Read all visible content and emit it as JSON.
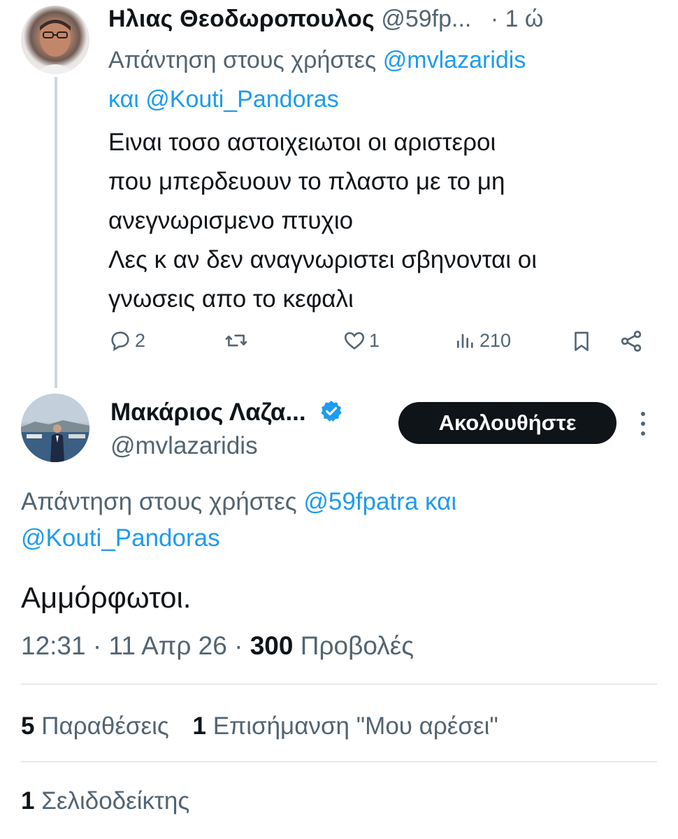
{
  "tweet1": {
    "author_name": "Ηλιας Θεοδωροπουλος",
    "author_handle": "@59fp...",
    "time": "· 1 ώ",
    "reply_prefix": "Απάντηση στους χρήστες",
    "mention_1": "@mvlazaridis",
    "connector": "και",
    "mention_2": "@Kouti_Pandoras",
    "text_lines": [
      "Ειναι τοσο αστοιχειωτοι οι αριστεροι",
      "που μπερδευουν το πλαστο με το μη",
      "ανεγνωρισμενο πτυχιο",
      "Λες κ αν δεν αναγνωριστει σβηνονται οι",
      "γνωσεις απο το κεφαλι"
    ],
    "actions": {
      "replies": "2",
      "reposts": "",
      "likes": "1",
      "views": "210"
    }
  },
  "tweet2": {
    "author_name": "Μακάριος Λαζα...",
    "author_handle": "@mvlazaridis",
    "follow_label": "Ακολουθήστε",
    "reply_prefix": "Απάντηση στους χρήστες",
    "mention_1": "@59fpatra",
    "connector": "και",
    "mention_2": "@Kouti_Pandoras",
    "text": "Αμμόρφωτοι.",
    "time": "12:31",
    "date": "11 Απρ 26",
    "views_count": "300",
    "views_label": "Προβολές",
    "quotes_count": "5",
    "quotes_label": "Παραθέσεις",
    "likes_count": "1",
    "likes_label": "Επισήμανση \"Μου αρέσει\"",
    "bookmarks_count": "1",
    "bookmarks_label": "Σελιδοδείκτης"
  },
  "colors": {
    "link": "#1d9bf0",
    "muted": "#536471",
    "text": "#0f1419",
    "divider": "#cfd9de"
  },
  "icons": [
    "reply-icon",
    "repost-icon",
    "like-icon",
    "views-icon",
    "bookmark-icon",
    "share-icon",
    "verified-badge-icon",
    "more-options-icon"
  ]
}
